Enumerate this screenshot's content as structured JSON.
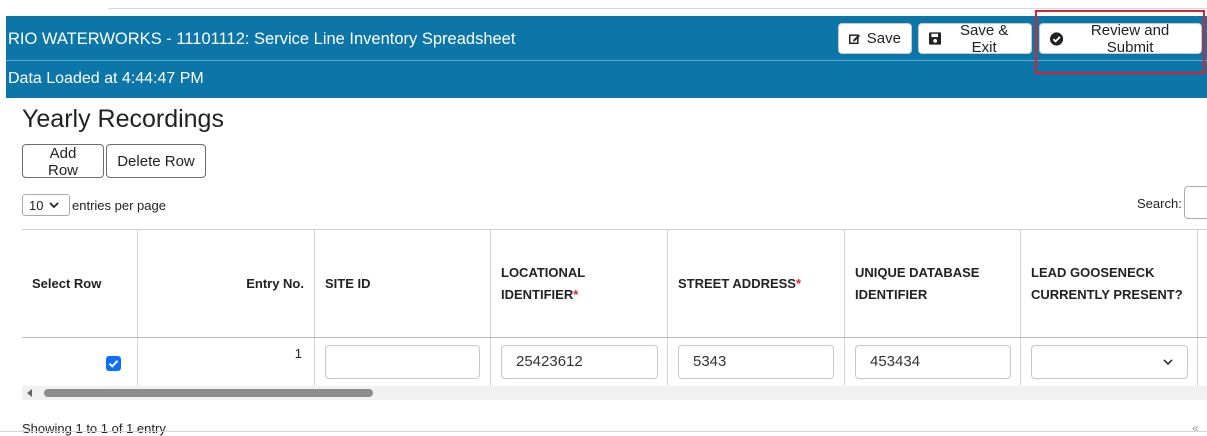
{
  "header": {
    "title": "RIO WATERWORKS - 11101112: Service Line Inventory Spreadsheet",
    "loaded_text": "Data Loaded at 4:44:47 PM",
    "buttons": {
      "save": "Save",
      "save_exit": "Save & Exit",
      "review_submit": "Review and Submit"
    },
    "highlight_color": "#d9232d",
    "bar_color": "#0c76a8"
  },
  "section": {
    "title": "Yearly Recordings",
    "add_row": "Add Row",
    "delete_row": "Delete Row"
  },
  "controls": {
    "page_size": "10",
    "entries_label": "entries per page",
    "search_label": "Search:",
    "search_value": ""
  },
  "table": {
    "headers": {
      "select_row": "Select Row",
      "entry_no": "Entry No.",
      "site_id": "SITE ID",
      "locational_line1": "LOCATIONAL",
      "locational_line2": "IDENTIFIER",
      "street_address": "STREET ADDRESS",
      "unique_line1": "UNIQUE DATABASE",
      "unique_line2": "IDENTIFIER",
      "lead_line1": "LEAD GOOSENECK",
      "lead_line2": "CURRENTLY PRESENT?",
      "required_mark": "*"
    },
    "rows": [
      {
        "selected": true,
        "entry_no": "1",
        "site_id": "",
        "locational_identifier": "25423612",
        "street_address": "5343",
        "unique_database_identifier": "453434",
        "lead_gooseneck": ""
      }
    ]
  },
  "footer": {
    "showing": "Showing 1 to 1 of 1 entry",
    "pager_hint": "«"
  },
  "icons": [
    "edit-icon",
    "floppy-disk-icon",
    "check-circle-icon",
    "chevron-down-icon",
    "checkmark-icon",
    "scroll-left-arrow-icon"
  ]
}
